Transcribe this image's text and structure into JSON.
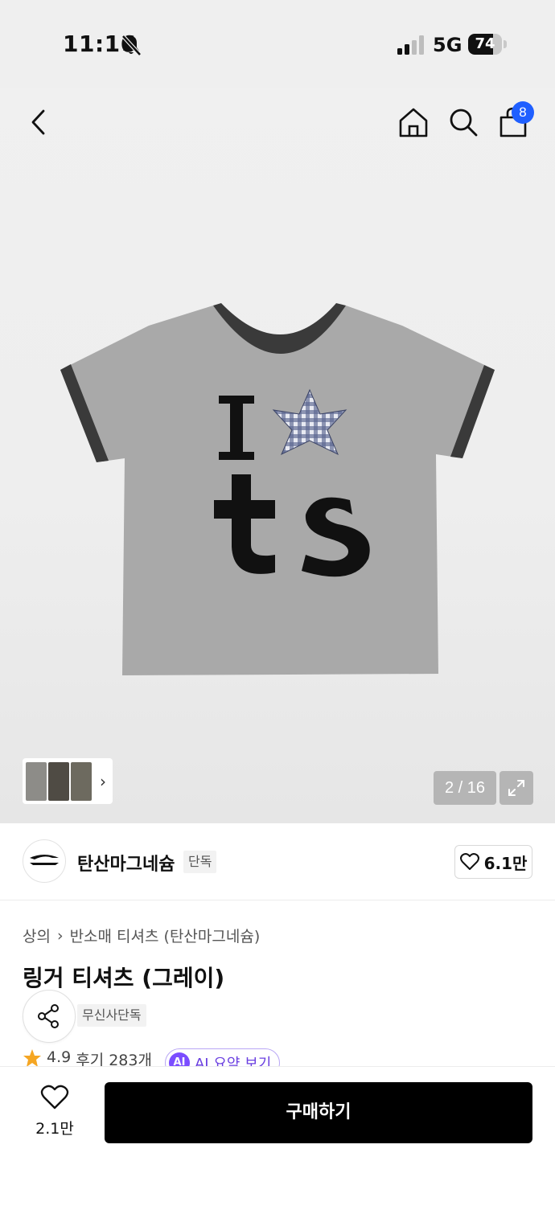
{
  "status_bar": {
    "time": "11:16",
    "network": "5G",
    "battery": "74",
    "battery_level": 0.74
  },
  "nav": {
    "cart_count": "8"
  },
  "gallery": {
    "counter": "2 / 16",
    "thumb_colors": [
      "#8d8c88",
      "#4f4b44",
      "#6d6a5f"
    ]
  },
  "brand": {
    "name": "탄산마그네슘",
    "tag": "단독",
    "likes": "6.1만"
  },
  "product": {
    "breadcrumb": [
      "상의",
      "반소매 티셔츠 (탄산마그네슘)"
    ],
    "title": "링거 티셔츠 (그레이)",
    "exclusive_tag": "무신사단독",
    "rating": "4.9",
    "reviews": "후기 283개",
    "ai_badge": "AI",
    "ai_summary": "AI 요약 보기"
  },
  "bottom_bar": {
    "wish_count": "2.1만",
    "buy_label": "구매하기"
  },
  "colors": {
    "accent_blue": "#1f5fff",
    "ai_purple": "#7b4dff",
    "rating_star": "#f5a623",
    "shirt_gray": "#a9a9a9",
    "trim": "#3a3a3a"
  }
}
